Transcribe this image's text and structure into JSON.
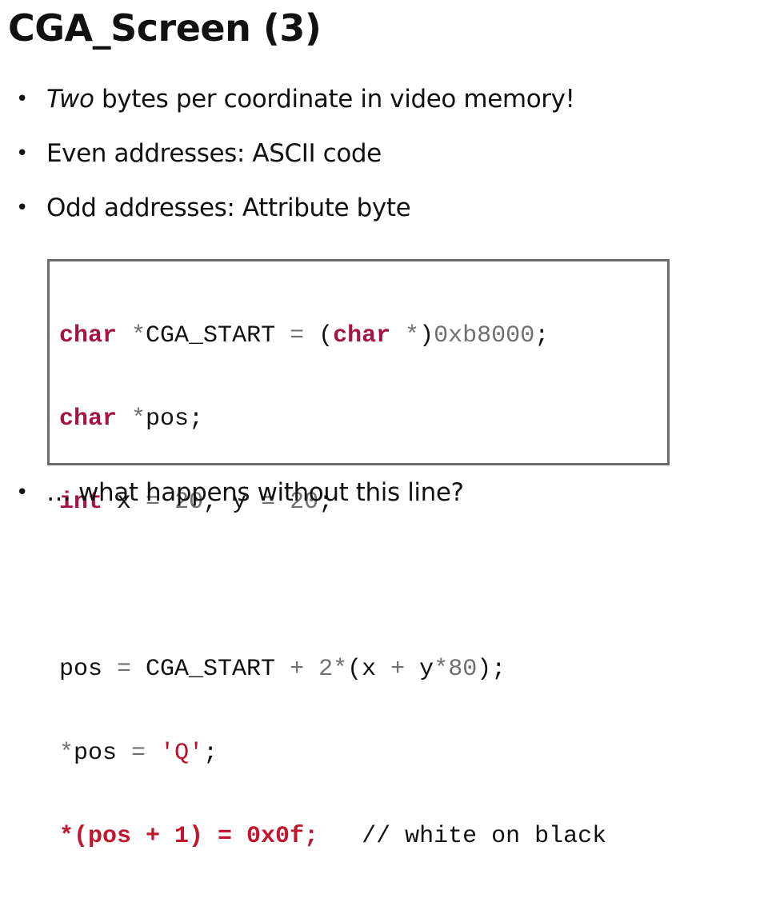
{
  "title": "CGA_Screen (3)",
  "bullet_char": "•",
  "bullets": [
    {
      "em": "Two",
      "rest": " bytes per coordinate in video memory!"
    },
    {
      "text": "Even addresses: ASCII code"
    },
    {
      "text": "Odd addresses: Attribute byte"
    },
    {
      "text": "… what happens without this line?"
    }
  ],
  "code": {
    "line1": {
      "kw1": "char",
      "p1": " ",
      "op1": "*",
      "p2": "CGA_START ",
      "op2": "=",
      "p3": " (",
      "kw2": "char",
      "p4": " ",
      "op3": "*",
      "p5": ")",
      "num1": "0xb8000",
      "p6": ";"
    },
    "line2": {
      "kw1": "char",
      "p1": " ",
      "op1": "*",
      "p2": "pos;"
    },
    "line3": {
      "kw1": "int",
      "p1": " x ",
      "op1": "=",
      "p2": " ",
      "num1": "20",
      "p3": ", y ",
      "op2": "=",
      "p4": " ",
      "num2": "20",
      "p5": ";"
    },
    "line5": {
      "p1": "pos ",
      "op1": "=",
      "p2": " CGA_START ",
      "op2": "+",
      "p3": " ",
      "num1": "2",
      "op3": "*",
      "p4": "(x ",
      "op4": "+",
      "p5": " y",
      "op5": "*",
      "num2": "80",
      "p6": ");"
    },
    "line6": {
      "op1": "*",
      "p1": "pos ",
      "op2": "=",
      "p2": " ",
      "str1": "'Q'",
      "p3": ";"
    },
    "line7": {
      "hl": "*(pos + 1) = 0x0f;",
      "p1": "   ",
      "cm": "// white on black"
    }
  },
  "colors": {
    "keyword": "#a31548",
    "operator": "#707070",
    "string": "#b5122e",
    "highlight": "#c0172e",
    "border": "#6b6b6b"
  }
}
